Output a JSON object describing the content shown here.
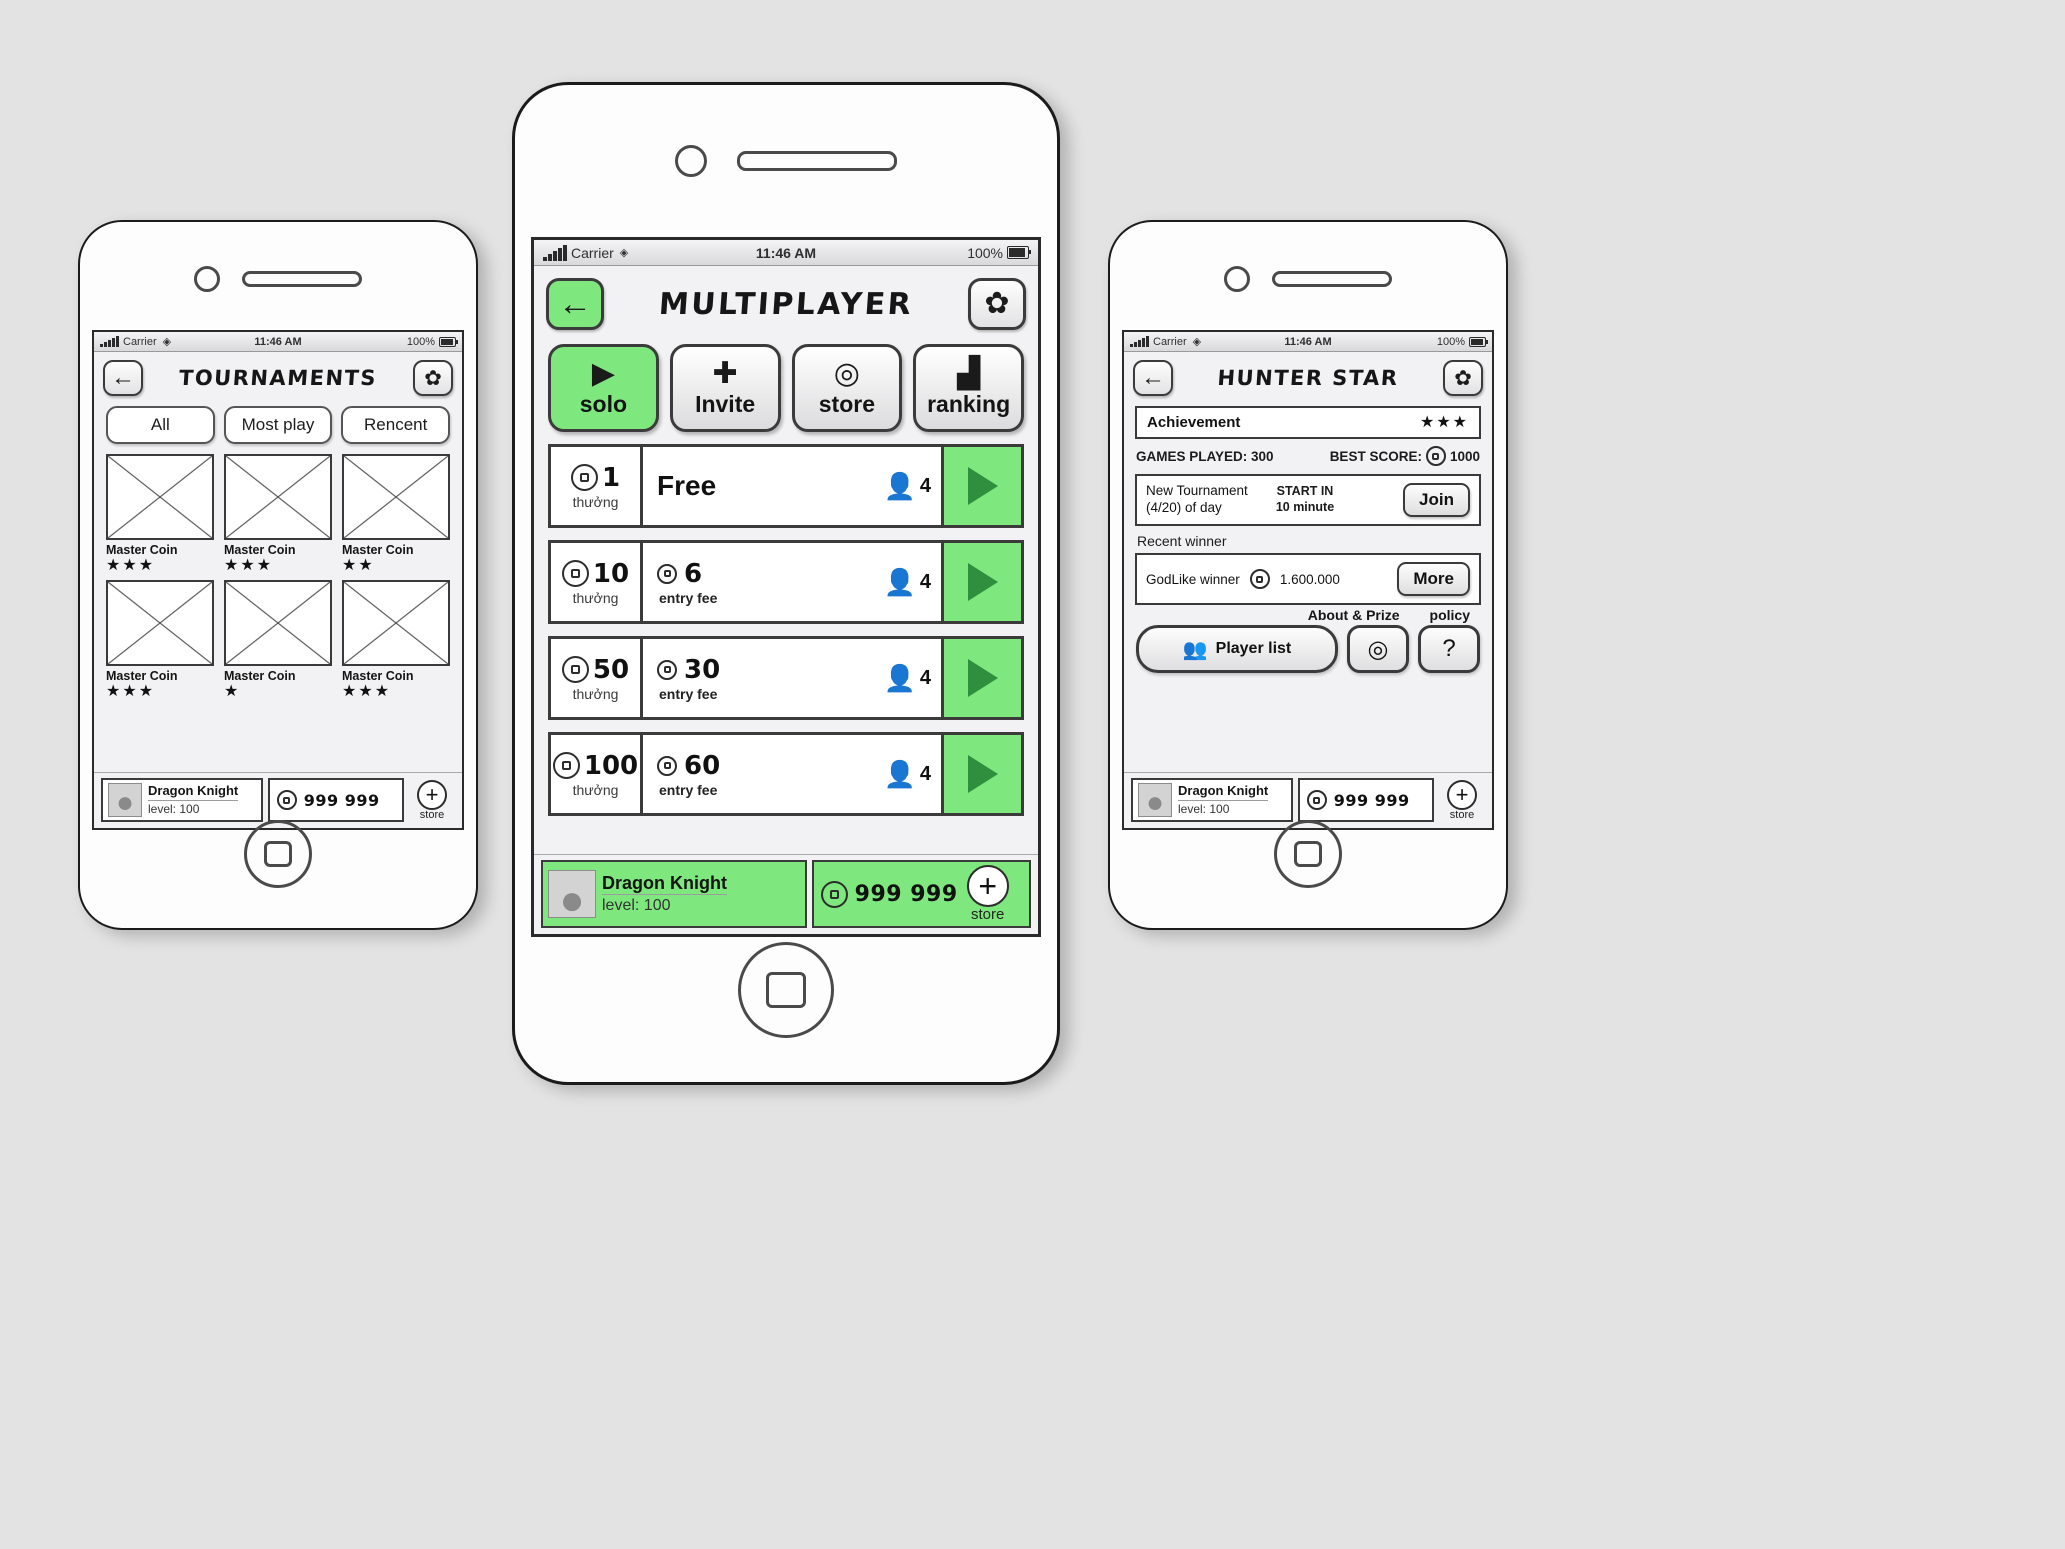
{
  "status_bar": {
    "carrier": "Carrier",
    "time": "11:46 AM",
    "battery": "100%"
  },
  "phone_left": {
    "title": "TOURNAMENTS",
    "back_icon": "arrow-left-icon",
    "settings_icon": "gear-icon",
    "tabs": [
      {
        "label": "All"
      },
      {
        "label": "Most play"
      },
      {
        "label": "Rencent"
      }
    ],
    "tiles": [
      {
        "name": "Master Coin",
        "stars": "★★★"
      },
      {
        "name": "Master Coin",
        "stars": "★★★"
      },
      {
        "name": "Master Coin",
        "stars": "★★"
      },
      {
        "name": "Master Coin",
        "stars": "★★★"
      },
      {
        "name": "Master Coin",
        "stars": "★"
      },
      {
        "name": "Master Coin",
        "stars": "★★★"
      }
    ],
    "player_bar": {
      "name": "Dragon Knight",
      "level": "level: 100",
      "coins": "999 999",
      "store_label": "store",
      "plus": "+"
    }
  },
  "phone_center": {
    "title": "MULTIPLAYER",
    "back_icon": "arrow-left-icon",
    "settings_icon": "gear-icon",
    "actions": [
      {
        "label": "solo",
        "icon": "play-icon",
        "active": true
      },
      {
        "label": "Invite",
        "icon": "plus-icon",
        "active": false
      },
      {
        "label": "store",
        "icon": "coins-icon",
        "active": false
      },
      {
        "label": "ranking",
        "icon": "podium-icon",
        "active": false
      }
    ],
    "rows": [
      {
        "prize": "1",
        "prize_label": "thưởng",
        "fee": "",
        "fee_label": "",
        "free_label": "Free",
        "players": "4"
      },
      {
        "prize": "10",
        "prize_label": "thưởng",
        "fee": "6",
        "fee_label": "entry fee",
        "free_label": "",
        "players": "4"
      },
      {
        "prize": "50",
        "prize_label": "thưởng",
        "fee": "30",
        "fee_label": "entry fee",
        "free_label": "",
        "players": "4"
      },
      {
        "prize": "100",
        "prize_label": "thưởng",
        "fee": "60",
        "fee_label": "entry fee",
        "free_label": "",
        "players": "4"
      }
    ],
    "player_bar": {
      "name": "Dragon Knight",
      "level": "level: 100",
      "coins": "999 999",
      "store_label": "store",
      "plus": "+"
    }
  },
  "phone_right": {
    "title": "HUNTER STAR",
    "back_icon": "arrow-left-icon",
    "settings_icon": "gear-icon",
    "achievement": {
      "label": "Achievement",
      "stars": "★★★"
    },
    "stats": {
      "games_played": "GAMES PLAYED: 300",
      "best_score_label": "BEST SCORE:",
      "best_score_value": "1000"
    },
    "tournament": {
      "name": "New Tournament",
      "sub": "(4/20) of day",
      "start_label": "START IN",
      "start_value": "10 minute",
      "join_label": "Join"
    },
    "recent_winner_label": "Recent winner",
    "winner": {
      "name": "GodLike winner",
      "amount": "1.600.000",
      "more_label": "More"
    },
    "about_caption": "About & Prize",
    "policy_caption": "policy",
    "player_list_label": "Player list",
    "prize_icon": "coin-icon",
    "policy_icon": "question-mark-icon",
    "player_list_icon": "people-icon",
    "player_bar": {
      "name": "Dragon Knight",
      "level": "level: 100",
      "coins": "999 999",
      "store_label": "store",
      "plus": "+"
    }
  },
  "colors": {
    "accent_green": "#7ee87e",
    "ink": "#1b1b1b",
    "screen_bg": "#f2f2f4"
  }
}
